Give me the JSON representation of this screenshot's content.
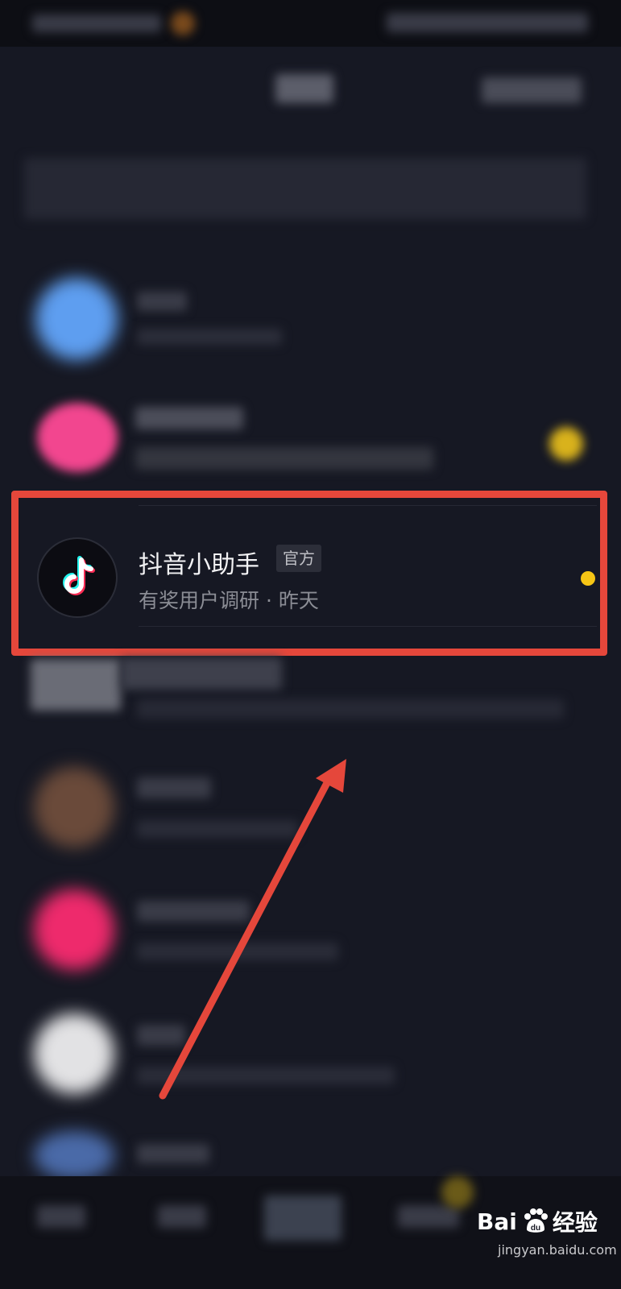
{
  "conversation": {
    "title": "抖音小助手",
    "badge": "官方",
    "preview": "有奖用户调研 · 昨天"
  },
  "watermark": {
    "brand_left": "Bai",
    "brand_right": "经验",
    "brand_mid": "du",
    "url": "jingyan.baidu.com"
  },
  "colors": {
    "background": "#161823",
    "highlight": "#e5473b",
    "unread_dot": "#f6c515"
  }
}
